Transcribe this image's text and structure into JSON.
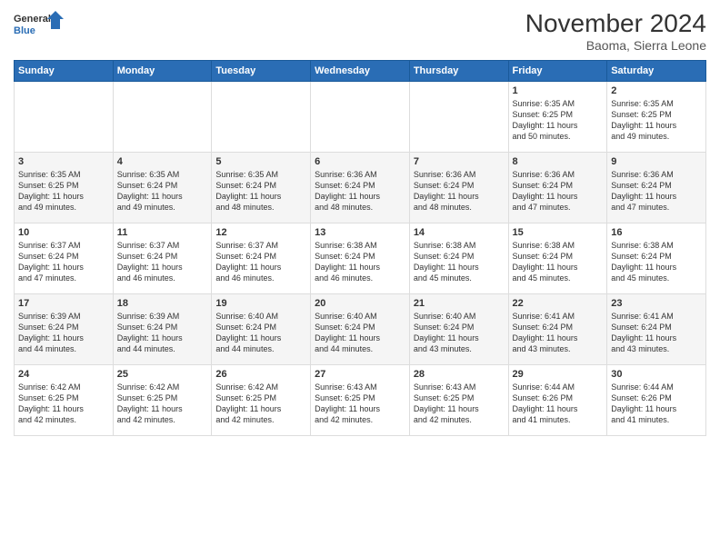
{
  "logo": {
    "line1": "General",
    "line2": "Blue"
  },
  "title": "November 2024",
  "location": "Baoma, Sierra Leone",
  "days_header": [
    "Sunday",
    "Monday",
    "Tuesday",
    "Wednesday",
    "Thursday",
    "Friday",
    "Saturday"
  ],
  "weeks": [
    [
      {
        "day": "",
        "info": ""
      },
      {
        "day": "",
        "info": ""
      },
      {
        "day": "",
        "info": ""
      },
      {
        "day": "",
        "info": ""
      },
      {
        "day": "",
        "info": ""
      },
      {
        "day": "1",
        "info": "Sunrise: 6:35 AM\nSunset: 6:25 PM\nDaylight: 11 hours\nand 50 minutes."
      },
      {
        "day": "2",
        "info": "Sunrise: 6:35 AM\nSunset: 6:25 PM\nDaylight: 11 hours\nand 49 minutes."
      }
    ],
    [
      {
        "day": "3",
        "info": "Sunrise: 6:35 AM\nSunset: 6:25 PM\nDaylight: 11 hours\nand 49 minutes."
      },
      {
        "day": "4",
        "info": "Sunrise: 6:35 AM\nSunset: 6:24 PM\nDaylight: 11 hours\nand 49 minutes."
      },
      {
        "day": "5",
        "info": "Sunrise: 6:35 AM\nSunset: 6:24 PM\nDaylight: 11 hours\nand 48 minutes."
      },
      {
        "day": "6",
        "info": "Sunrise: 6:36 AM\nSunset: 6:24 PM\nDaylight: 11 hours\nand 48 minutes."
      },
      {
        "day": "7",
        "info": "Sunrise: 6:36 AM\nSunset: 6:24 PM\nDaylight: 11 hours\nand 48 minutes."
      },
      {
        "day": "8",
        "info": "Sunrise: 6:36 AM\nSunset: 6:24 PM\nDaylight: 11 hours\nand 47 minutes."
      },
      {
        "day": "9",
        "info": "Sunrise: 6:36 AM\nSunset: 6:24 PM\nDaylight: 11 hours\nand 47 minutes."
      }
    ],
    [
      {
        "day": "10",
        "info": "Sunrise: 6:37 AM\nSunset: 6:24 PM\nDaylight: 11 hours\nand 47 minutes."
      },
      {
        "day": "11",
        "info": "Sunrise: 6:37 AM\nSunset: 6:24 PM\nDaylight: 11 hours\nand 46 minutes."
      },
      {
        "day": "12",
        "info": "Sunrise: 6:37 AM\nSunset: 6:24 PM\nDaylight: 11 hours\nand 46 minutes."
      },
      {
        "day": "13",
        "info": "Sunrise: 6:38 AM\nSunset: 6:24 PM\nDaylight: 11 hours\nand 46 minutes."
      },
      {
        "day": "14",
        "info": "Sunrise: 6:38 AM\nSunset: 6:24 PM\nDaylight: 11 hours\nand 45 minutes."
      },
      {
        "day": "15",
        "info": "Sunrise: 6:38 AM\nSunset: 6:24 PM\nDaylight: 11 hours\nand 45 minutes."
      },
      {
        "day": "16",
        "info": "Sunrise: 6:38 AM\nSunset: 6:24 PM\nDaylight: 11 hours\nand 45 minutes."
      }
    ],
    [
      {
        "day": "17",
        "info": "Sunrise: 6:39 AM\nSunset: 6:24 PM\nDaylight: 11 hours\nand 44 minutes."
      },
      {
        "day": "18",
        "info": "Sunrise: 6:39 AM\nSunset: 6:24 PM\nDaylight: 11 hours\nand 44 minutes."
      },
      {
        "day": "19",
        "info": "Sunrise: 6:40 AM\nSunset: 6:24 PM\nDaylight: 11 hours\nand 44 minutes."
      },
      {
        "day": "20",
        "info": "Sunrise: 6:40 AM\nSunset: 6:24 PM\nDaylight: 11 hours\nand 44 minutes."
      },
      {
        "day": "21",
        "info": "Sunrise: 6:40 AM\nSunset: 6:24 PM\nDaylight: 11 hours\nand 43 minutes."
      },
      {
        "day": "22",
        "info": "Sunrise: 6:41 AM\nSunset: 6:24 PM\nDaylight: 11 hours\nand 43 minutes."
      },
      {
        "day": "23",
        "info": "Sunrise: 6:41 AM\nSunset: 6:24 PM\nDaylight: 11 hours\nand 43 minutes."
      }
    ],
    [
      {
        "day": "24",
        "info": "Sunrise: 6:42 AM\nSunset: 6:25 PM\nDaylight: 11 hours\nand 42 minutes."
      },
      {
        "day": "25",
        "info": "Sunrise: 6:42 AM\nSunset: 6:25 PM\nDaylight: 11 hours\nand 42 minutes."
      },
      {
        "day": "26",
        "info": "Sunrise: 6:42 AM\nSunset: 6:25 PM\nDaylight: 11 hours\nand 42 minutes."
      },
      {
        "day": "27",
        "info": "Sunrise: 6:43 AM\nSunset: 6:25 PM\nDaylight: 11 hours\nand 42 minutes."
      },
      {
        "day": "28",
        "info": "Sunrise: 6:43 AM\nSunset: 6:25 PM\nDaylight: 11 hours\nand 42 minutes."
      },
      {
        "day": "29",
        "info": "Sunrise: 6:44 AM\nSunset: 6:26 PM\nDaylight: 11 hours\nand 41 minutes."
      },
      {
        "day": "30",
        "info": "Sunrise: 6:44 AM\nSunset: 6:26 PM\nDaylight: 11 hours\nand 41 minutes."
      }
    ]
  ]
}
